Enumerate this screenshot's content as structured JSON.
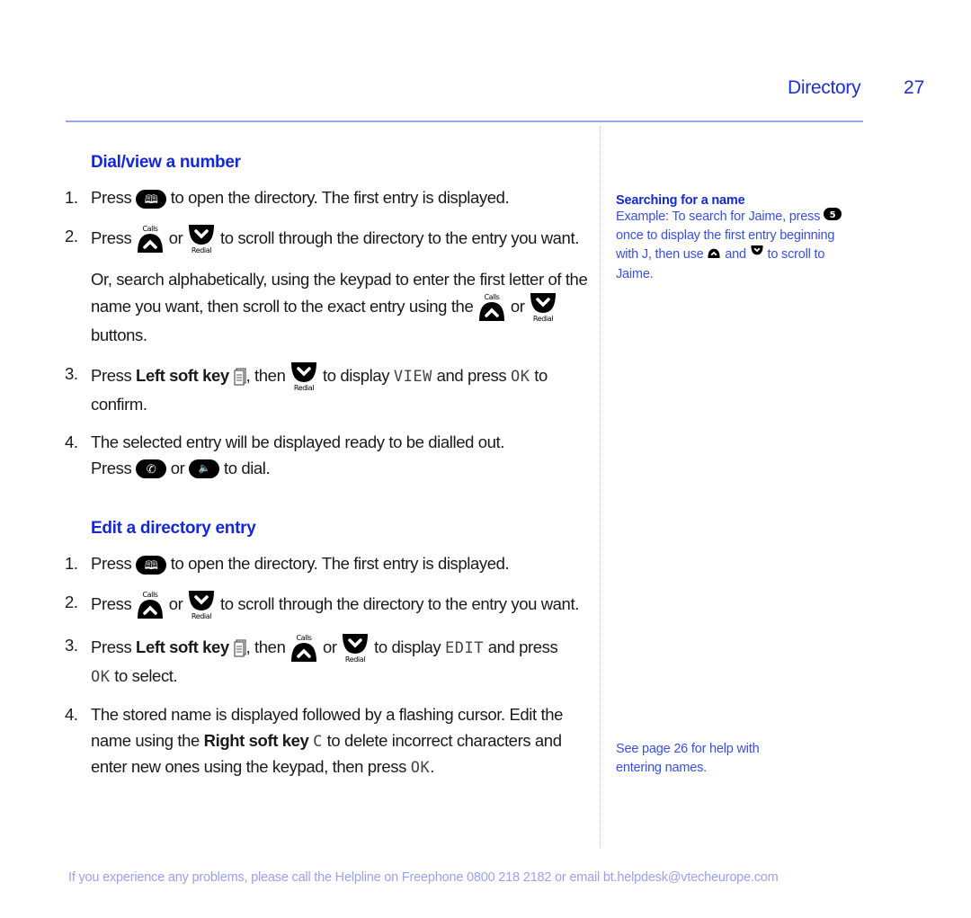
{
  "header": {
    "section": "Directory",
    "page_number": "27"
  },
  "colors": {
    "heading_blue": "#1428d8",
    "side_text_blue": "#3b4fe0",
    "rule_blue": "#98a4f0",
    "footer_blue": "#9aa2ee"
  },
  "icons": {
    "directory": "book-icon",
    "up_calls": "calls-up-icon",
    "down_redial": "redial-down-icon",
    "left_soft_key": "left-soft-key-icon",
    "talk": "phone-talk-icon",
    "speaker": "speakerphone-icon",
    "key5": "key-5-icon"
  },
  "icon_labels": {
    "calls": "Calls",
    "redial": "Redial"
  },
  "dial_section": {
    "title": "Dial/view a number",
    "step1": {
      "num": "1.",
      "a": "Press",
      "b": "to open the directory. The first entry is displayed."
    },
    "step2": {
      "num": "2.",
      "a": "Press",
      "or": "or",
      "b": "to scroll through the directory to the entry you want."
    },
    "alt_para": {
      "a": "Or, search alphabetically, using the keypad to enter the first letter of the name you want, then scroll to the exact entry using the",
      "or": "or",
      "b": "buttons."
    },
    "step3": {
      "num": "3.",
      "a": "Press",
      "bold": "Left soft key",
      "b": ", then",
      "c": "to display",
      "lcd1": "VIEW",
      "d": "and press",
      "lcd2": "OK",
      "e": "to confirm."
    },
    "step4": {
      "num": "4.",
      "a": "The selected entry will be displayed ready to be dialled out.",
      "b": "Press",
      "or": "or",
      "c": "to dial."
    }
  },
  "edit_section": {
    "title": "Edit a directory entry",
    "step1": {
      "num": "1.",
      "a": "Press",
      "b": "to open the directory. The first entry is displayed."
    },
    "step2": {
      "num": "2.",
      "a": "Press",
      "or": "or",
      "b": "to scroll through the directory to the entry you want."
    },
    "step3": {
      "num": "3.",
      "a": "Press",
      "bold": "Left soft key",
      "b": ", then",
      "or": "or",
      "c": "to display",
      "lcd1": "EDIT",
      "d": "and press",
      "lcd2": "OK",
      "e": "to select."
    },
    "step4": {
      "num": "4.",
      "a": "The stored name is displayed followed by a flashing cursor. Edit the name using the",
      "bold": "Right soft key",
      "lcd1": "C",
      "b": "to delete incorrect characters and enter new ones using the keypad, then press",
      "lcd2": "OK",
      "end": "."
    }
  },
  "sidebar": {
    "tip1": {
      "title": "Searching for a name",
      "a": "Example: To search for Jaime, press",
      "b": "once to display the first entry beginning with J, then use",
      "and": "and",
      "c": "to scroll to Jaime."
    },
    "tip2": "See page 26 for help with entering names."
  },
  "footer": "If you experience any problems, please call the Helpline on Freephone 0800 218 2182 or email bt.helpdesk@vtecheurope.com"
}
